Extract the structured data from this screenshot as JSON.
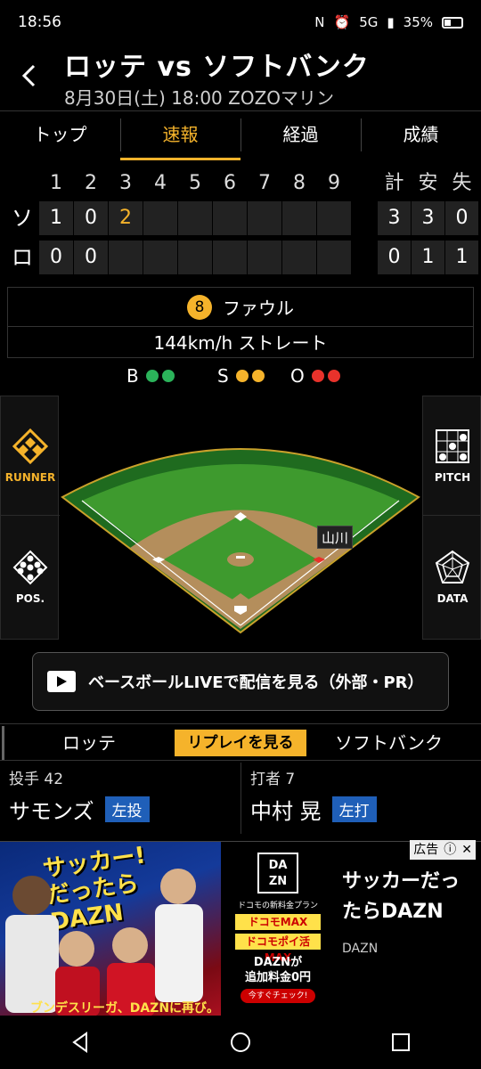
{
  "status": {
    "time": "18:56",
    "battery": "35%",
    "network": "5G"
  },
  "header": {
    "title": "ロッテ vs ソフトバンク",
    "subtitle": "8月30日(土) 18:00 ZOZOマリン"
  },
  "tabs": [
    {
      "label": "トップ"
    },
    {
      "label": "速報"
    },
    {
      "label": "経過"
    },
    {
      "label": "成績"
    }
  ],
  "scoreboard": {
    "innings": [
      "1",
      "2",
      "3",
      "4",
      "5",
      "6",
      "7",
      "8",
      "9"
    ],
    "totals_headers": [
      "計",
      "安",
      "失"
    ],
    "teams": [
      {
        "abbr": "ソ",
        "innings": [
          "1",
          "0",
          "2",
          "",
          "",
          "",
          "",
          "",
          ""
        ],
        "totals": [
          "3",
          "3",
          "0"
        ]
      },
      {
        "abbr": "ロ",
        "innings": [
          "0",
          "0",
          "",
          "",
          "",
          "",
          "",
          "",
          ""
        ],
        "totals": [
          "0",
          "1",
          "1"
        ]
      }
    ]
  },
  "play": {
    "pitch_number": "8",
    "result": "ファウル",
    "pitch": "144km/h ストレート"
  },
  "count": {
    "b_label": "B",
    "s_label": "S",
    "o_label": "O",
    "balls": 2,
    "strikes": 2,
    "outs": 2
  },
  "side_buttons": {
    "runner": "RUNNER",
    "pos": "POS.",
    "pitch": "PITCH",
    "data": "DATA"
  },
  "field": {
    "batter_tag": "山川"
  },
  "live_button": {
    "label": "ベースボールLIVEで配信を見る（外部・PR）"
  },
  "team_tabs": {
    "left": "ロッテ",
    "replay": "リプレイを見る",
    "right": "ソフトバンク"
  },
  "pitcher": {
    "role": "投手 42",
    "name": "サモンズ",
    "badge": "左投"
  },
  "batter": {
    "role": "打者 7",
    "name": "中村 晃",
    "badge": "左打"
  },
  "ad": {
    "label": "広告",
    "headline1": "サッカー!",
    "headline2": "だったら",
    "headline3": "DAZN",
    "sub": "ブンデスリーガ、DAZNに再び。",
    "logo_top": "DA",
    "logo_bottom": "ZN",
    "small1": "ドコモの新料金プラン",
    "pill1": "ドコモMAX",
    "pill2": "ドコモポイ活MAX",
    "offer1": "DAZNが",
    "offer2": "追加料金0円",
    "check": "今すぐチェック!",
    "copy": "サッカーだったらDAZN",
    "brand": "DAZN"
  },
  "colors": {
    "accent": "#f5b32b",
    "ball": "#2bb35a",
    "strike": "#f5b32b",
    "out": "#e8322b",
    "badge": "#1f5fb8"
  }
}
